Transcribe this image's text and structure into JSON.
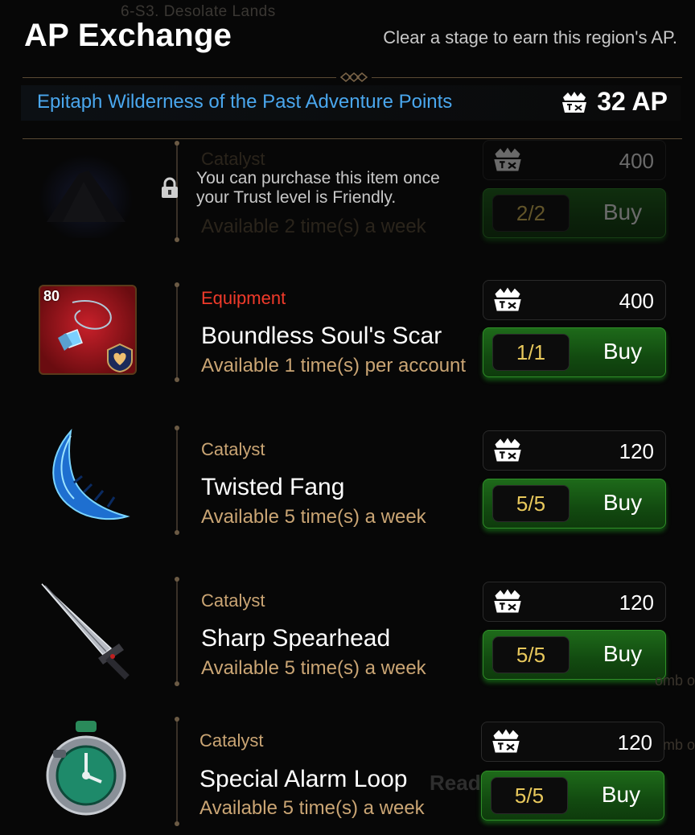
{
  "background": {
    "stage_ghost": "6-S3. Desolate Lands",
    "ready_ghost": "Ready",
    "side_ghost_1": "omb o",
    "side_ghost_2": "6-",
    "side_ghost_3": "omb o"
  },
  "header": {
    "title": "AP Exchange",
    "hint": "Clear a stage to earn this region's AP."
  },
  "region": {
    "name": "Epitaph Wilderness of the Past Adventure Points",
    "ap_total": "32 AP",
    "ap_icon": "ap-token-icon"
  },
  "locked_message": "You can purchase this item once your Trust level is Friendly.",
  "items": [
    {
      "category": "Catalyst",
      "name": "",
      "availability": "Available 2 time(s) a week",
      "price": "400",
      "count": "2/2",
      "buy_label": "Buy",
      "icon": "dark-ore-pile-icon",
      "locked": true
    },
    {
      "category": "Equipment",
      "name": "Boundless Soul's Scar",
      "availability": "Available 1 time(s) per account",
      "price": "400",
      "count": "1/1",
      "buy_label": "Buy",
      "icon": "crystal-pendant-icon",
      "level": "80",
      "locked": false
    },
    {
      "category": "Catalyst",
      "name": "Twisted Fang",
      "availability": "Available 5 time(s) a week",
      "price": "120",
      "count": "5/5",
      "buy_label": "Buy",
      "icon": "blue-fang-icon",
      "locked": false
    },
    {
      "category": "Catalyst",
      "name": "Sharp Spearhead",
      "availability": "Available 5 time(s) a week",
      "price": "120",
      "count": "5/5",
      "buy_label": "Buy",
      "icon": "spearhead-icon",
      "locked": false
    },
    {
      "category": "Catalyst",
      "name": "Special Alarm Loop",
      "availability": "Available 5 time(s) a week",
      "price": "120",
      "count": "5/5",
      "buy_label": "Buy",
      "icon": "alarm-clock-icon",
      "locked": false
    }
  ],
  "colors": {
    "region_text": "#4aa7ee",
    "category": "#caa574",
    "equipment": "#f03a2a",
    "buy_green": "#1e6b1a",
    "count_gold": "#e8c85c"
  }
}
